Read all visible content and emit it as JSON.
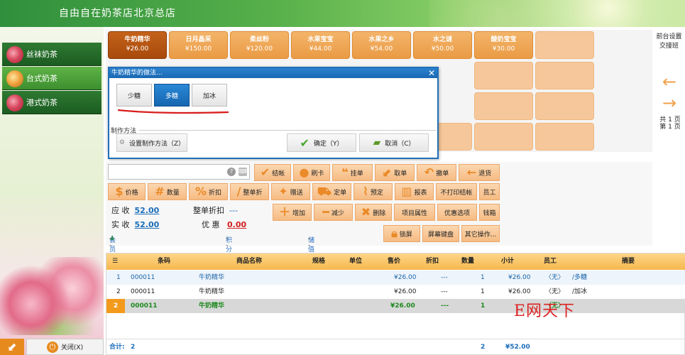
{
  "header": {
    "title": "自由自在奶茶店北京总店"
  },
  "categories": [
    {
      "label": "丝袜奶茶",
      "selected": false
    },
    {
      "label": "台式奶茶",
      "selected": true
    },
    {
      "label": "港式奶茶",
      "selected": false
    }
  ],
  "products": [
    {
      "name": "牛奶精华",
      "price": "¥26.00"
    },
    {
      "name": "日月晶采",
      "price": "¥150.00"
    },
    {
      "name": "柔丝粉",
      "price": "¥120.00"
    },
    {
      "name": "水果宝宝",
      "price": "¥44.00"
    },
    {
      "name": "水果之乡",
      "price": "¥54.00"
    },
    {
      "name": "水之谜",
      "price": "¥50.00"
    },
    {
      "name": "酸奶宝宝",
      "price": "¥30.00"
    }
  ],
  "right_panel": {
    "front_settings": "前台设置",
    "shift": "交接班",
    "page_total": "共 1 页",
    "page_current": "第 1 页"
  },
  "dialog": {
    "title": "牛奶精华的做法...",
    "options": [
      {
        "label": "少糖",
        "selected": false
      },
      {
        "label": "多糖",
        "selected": true
      },
      {
        "label": "加冰",
        "selected": false
      }
    ],
    "group_label": "制作方法",
    "set_method": "设置制作方法（Z）",
    "ok": "确定（Y）",
    "cancel": "取消（C）"
  },
  "toolbar": {
    "row1": [
      "结帐",
      "刷卡",
      "挂单",
      "取单",
      "撤单",
      "退货"
    ],
    "row2": [
      "价格",
      "数量",
      "折扣",
      "整单折",
      "赠送",
      "定单",
      "预定",
      "报表",
      "不打印结帐",
      "员工"
    ],
    "row3": [
      "增加",
      "减少",
      "删除",
      "项目属性",
      "优惠选项",
      "钱箱"
    ],
    "row4": [
      "锁屏",
      "屏幕键盘",
      "其它操作..."
    ]
  },
  "summary": {
    "receivable_label": "应 收",
    "receivable": "52.00",
    "discount_label": "整单折扣",
    "discount": "---",
    "paid_label": "实 收",
    "paid": "52.00",
    "benefit_label": "优 惠",
    "benefit": "0.00",
    "member_label": "会员",
    "member": "--",
    "points_label": "积分",
    "points": "--",
    "stored_label": "储值",
    "stored": "--"
  },
  "table": {
    "headers": [
      "条码",
      "商品名称",
      "规格",
      "单位",
      "售价",
      "折扣",
      "数量",
      "小计",
      "员工",
      "摘要"
    ],
    "rows": [
      {
        "no": "1",
        "code": "000011",
        "name": "牛奶精华",
        "price": "¥26.00",
        "discount": "---",
        "qty": "1",
        "subtotal": "¥26.00",
        "staff": "〈无〉",
        "note": "/多糖"
      },
      {
        "no": "2",
        "code": "000011",
        "name": "牛奶精华",
        "price": "¥26.00",
        "discount": "---",
        "qty": "1",
        "subtotal": "¥26.00",
        "staff": "〈无〉",
        "note": "/加冰"
      },
      {
        "no": "2",
        "code": "000011",
        "name": "牛奶精华",
        "price": "¥26.00",
        "discount": "---",
        "qty": "1",
        "subtotal": "",
        "staff": "〈无〉",
        "note": ""
      }
    ],
    "footer": {
      "label": "合计:",
      "count": "2",
      "qty": "2",
      "total": "¥52.00"
    }
  },
  "bottom_left": {
    "back": "K",
    "close": "关闭(X)"
  },
  "watermark": "E网天下"
}
